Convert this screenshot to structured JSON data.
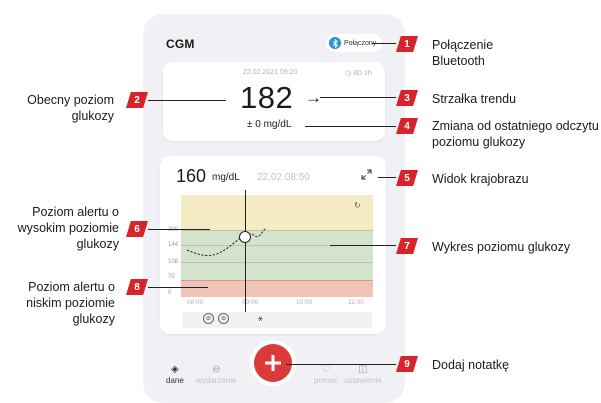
{
  "app": {
    "title": "CGM",
    "bluetooth_status": "Połączony"
  },
  "current_card": {
    "timestamp": "22.02.2021 09:20",
    "sensor_info": "8D 1h",
    "glucose_value": "182",
    "trend_arrow": "→",
    "change": "± 0 mg/dL"
  },
  "graph_card": {
    "value": "160",
    "unit": "mg/dL",
    "time": "22.02 08:50",
    "y_ticks": [
      "200",
      "144",
      "108",
      "70",
      "0"
    ],
    "x_ticks": [
      "08:00",
      "09:00",
      "10:00",
      "11:00"
    ],
    "colors": {
      "high_zone": "#f5ecc6",
      "target_zone": "#d4e3cc",
      "low_zone": "#f2c4b8"
    }
  },
  "tabs": [
    {
      "label": "dane",
      "icon": "drop-icon",
      "active": true
    },
    {
      "label": "wydarzenie",
      "icon": "events-icon",
      "active": false
    },
    {
      "label": "pomoc",
      "icon": "heart-icon",
      "active": false
    },
    {
      "label": "ustawienie",
      "icon": "settings-icon",
      "active": false
    }
  ],
  "callouts": {
    "c1": {
      "num": "1",
      "text": "Połączenie Bluetooth"
    },
    "c2": {
      "num": "2",
      "text": "Obecny poziom glukozy"
    },
    "c3": {
      "num": "3",
      "text": "Strzałka trendu"
    },
    "c4": {
      "num": "4",
      "text": "Zmiana od ostatniego odczytu poziomu glukozy"
    },
    "c5": {
      "num": "5",
      "text": "Widok krajobrazu"
    },
    "c6": {
      "num": "6",
      "text": "Poziom alertu o wysokim poziomie glukozy"
    },
    "c7": {
      "num": "7",
      "text": "Wykres poziomu glukozy"
    },
    "c8": {
      "num": "8",
      "text": "Poziom alertu o niskim poziomie glukozy"
    },
    "c9": {
      "num": "9",
      "text": "Dodaj notatkę"
    }
  },
  "accent_color": "#d8232a"
}
